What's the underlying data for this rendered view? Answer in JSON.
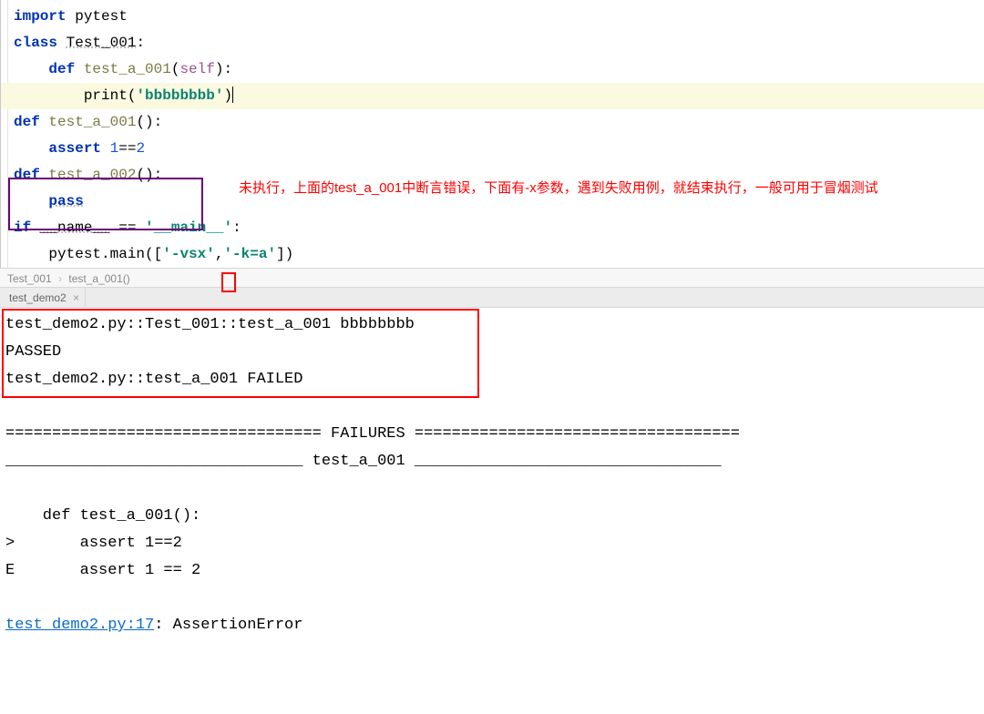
{
  "code": {
    "line1_import": "import",
    "line1_mod": "pytest",
    "line2_class": "class",
    "line2_name": "Test_001",
    "line3_def": "def",
    "line3_name": "test_a_001",
    "line3_self": "self",
    "line4_call": "print",
    "line4_str": "'bbbbbbbb'",
    "line5_def": "def",
    "line5_name": "test_a_001",
    "line6_assert": "assert",
    "line6_expr_a": "1",
    "line6_expr_op": "==",
    "line6_expr_b": "2",
    "line7_def": "def",
    "line7_name": "test_a_002",
    "line8_pass": "pass",
    "line9_if": "if",
    "line9_name": "__name__",
    "line9_eq": "==",
    "line9_main": "'__main__'",
    "line10_call_a": "pytest",
    "line10_call_b": ".main([",
    "line10_arg1": "'-vsx'",
    "line10_comma": ",",
    "line10_arg2": "'-k=a'",
    "line10_close": "])"
  },
  "annotation": "未执行，上面的test_a_001中断言错误，下面有-x参数，遇到失败用例，就结束执行，一般可用于冒烟测试",
  "breadcrumb": {
    "item1": "Test_001",
    "item2": "test_a_001()"
  },
  "tab": {
    "name": "test_demo2"
  },
  "console": {
    "l1": "test_demo2.py::Test_001::test_a_001 bbbbbbbb",
    "l2": "PASSED",
    "l3": "test_demo2.py::test_a_001 FAILED",
    "failures_header": "================================== FAILURES ===================================",
    "failures_name": "________________________________ test_a_001 _________________________________",
    "fn_def": "    def test_a_001():",
    "fn_assert": ">       assert 1==2",
    "fn_err": "E       assert 1 == 2",
    "trace_file": "test_demo2.py:17",
    "trace_err": ": AssertionError"
  }
}
